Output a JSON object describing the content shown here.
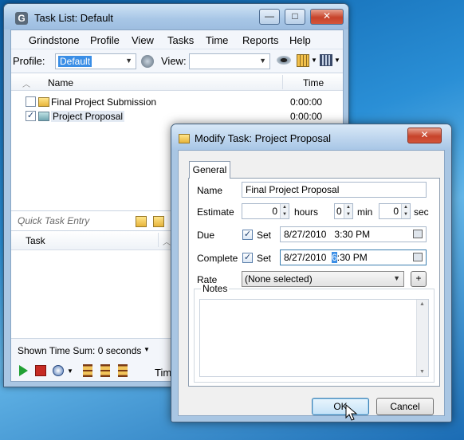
{
  "main_window": {
    "title": "Task List: Default",
    "logo_letter": "G",
    "buttons": {
      "minimize": "—",
      "maximize": "□",
      "close": "✕"
    }
  },
  "menu": [
    "Grindstone",
    "Profile",
    "View",
    "Tasks",
    "Time",
    "Reports",
    "Help"
  ],
  "toolbar": {
    "profile_label": "Profile:",
    "profile_value": "Default",
    "view_label": "View:",
    "view_value": ""
  },
  "task_list": {
    "col_name": "Name",
    "col_time": "Time",
    "rows": [
      {
        "name": "Final Project Submission",
        "time": "0:00:00",
        "checked": false
      },
      {
        "name": "Project Proposal",
        "time": "0:00:00",
        "checked": true
      }
    ]
  },
  "quick_entry": {
    "placeholder": "Quick Task Entry"
  },
  "lower_panel": {
    "col_task": "Task"
  },
  "status": {
    "time_sum": "Shown Time Sum: 0 seconds",
    "time_label": "Tim"
  },
  "dialog": {
    "title": "Modify Task: Project Proposal",
    "tab": "General",
    "name_label": "Name",
    "name_value": "Final Project Proposal",
    "estimate_label": "Estimate",
    "estimate_hours": "0",
    "hours_label": "hours",
    "estimate_min": "0",
    "min_label": "min",
    "estimate_sec": "0",
    "sec_label": "sec",
    "due_label": "Due",
    "due_set_label": "Set",
    "due_date": "8/27/2010",
    "due_time": "3:30 PM",
    "complete_label": "Complete",
    "complete_set_label": "Set",
    "complete_date": "8/27/2010",
    "complete_time_hl": "6",
    "complete_time_rest": ":30 PM",
    "rate_label": "Rate",
    "rate_value": "(None selected)",
    "rate_add": "+",
    "notes_label": "Notes",
    "ok": "OK",
    "cancel": "Cancel"
  }
}
